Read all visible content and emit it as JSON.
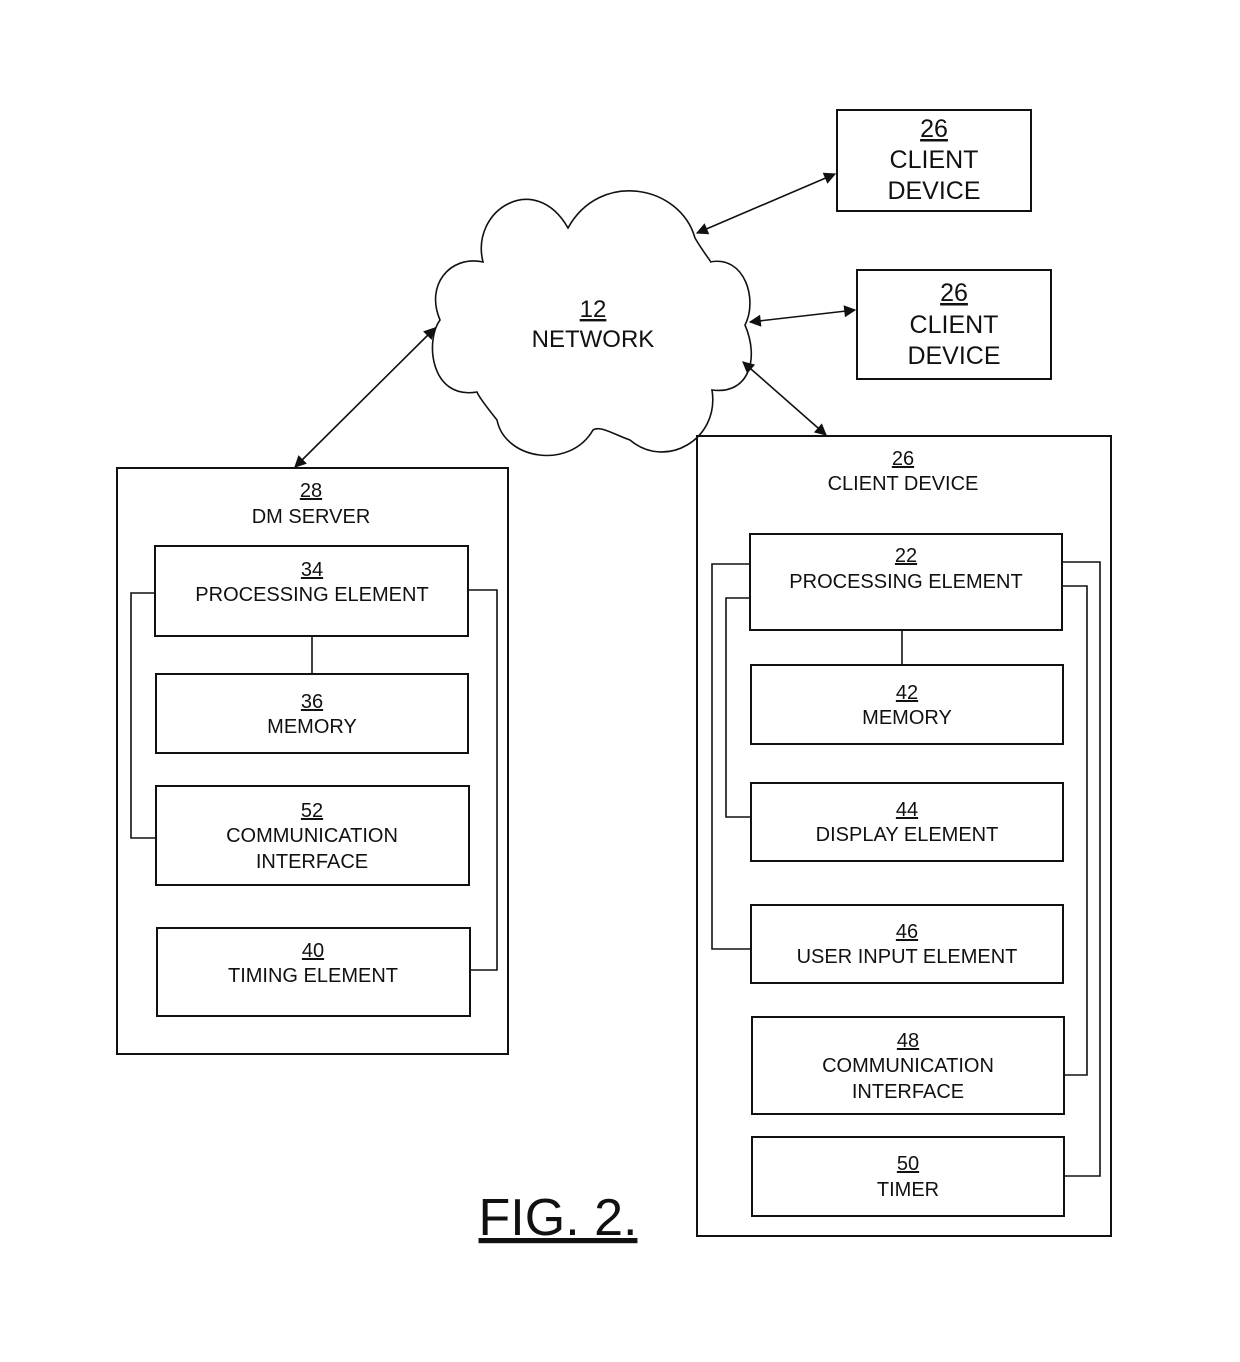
{
  "figure": {
    "caption": "FIG. 2."
  },
  "network": {
    "ref": "12",
    "label": "NETWORK"
  },
  "external_clients": [
    {
      "ref": "26",
      "line1": "CLIENT",
      "line2": "DEVICE"
    },
    {
      "ref": "26",
      "line1": "CLIENT",
      "line2": "DEVICE"
    }
  ],
  "dm_server": {
    "ref": "28",
    "label": "DM SERVER",
    "components": [
      {
        "ref": "34",
        "lines": [
          "PROCESSING ELEMENT"
        ]
      },
      {
        "ref": "36",
        "lines": [
          "MEMORY"
        ]
      },
      {
        "ref": "52",
        "lines": [
          "COMMUNICATION",
          "INTERFACE"
        ]
      },
      {
        "ref": "40",
        "lines": [
          "TIMING ELEMENT"
        ]
      }
    ]
  },
  "client_device": {
    "ref": "26",
    "label": "CLIENT DEVICE",
    "components": [
      {
        "ref": "22",
        "lines": [
          "PROCESSING ELEMENT"
        ]
      },
      {
        "ref": "42",
        "lines": [
          "MEMORY"
        ]
      },
      {
        "ref": "44",
        "lines": [
          "DISPLAY ELEMENT"
        ]
      },
      {
        "ref": "46",
        "lines": [
          "USER INPUT ELEMENT"
        ]
      },
      {
        "ref": "48",
        "lines": [
          "COMMUNICATION",
          "INTERFACE"
        ]
      },
      {
        "ref": "50",
        "lines": [
          "TIMER"
        ]
      }
    ]
  }
}
